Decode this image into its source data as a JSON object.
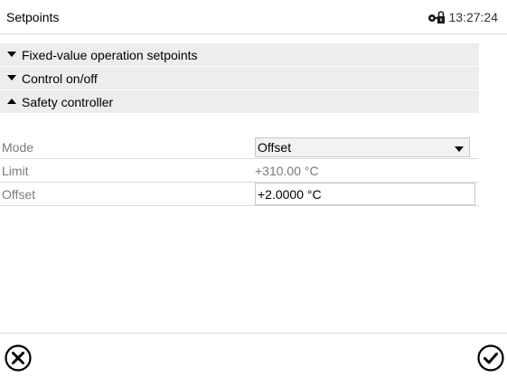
{
  "header": {
    "title": "Setpoints",
    "time": "13:27:24",
    "lock_icon": "lock-key-icon"
  },
  "sections": [
    {
      "label": "Fixed-value operation setpoints",
      "state": "collapsed",
      "icon": "triangle-down-icon"
    },
    {
      "label": "Control on/off",
      "state": "collapsed",
      "icon": "triangle-down-icon"
    },
    {
      "label": "Safety controller",
      "state": "expanded",
      "icon": "triangle-up-icon"
    }
  ],
  "fields": {
    "mode": {
      "label": "Mode",
      "value": "Offset"
    },
    "limit": {
      "label": "Limit",
      "value": "+310.00 °C"
    },
    "offset": {
      "label": "Offset",
      "value": "+2.0000 °C"
    }
  },
  "footer": {
    "cancel_icon": "cancel-circle-icon",
    "confirm_icon": "confirm-check-circle-icon"
  }
}
